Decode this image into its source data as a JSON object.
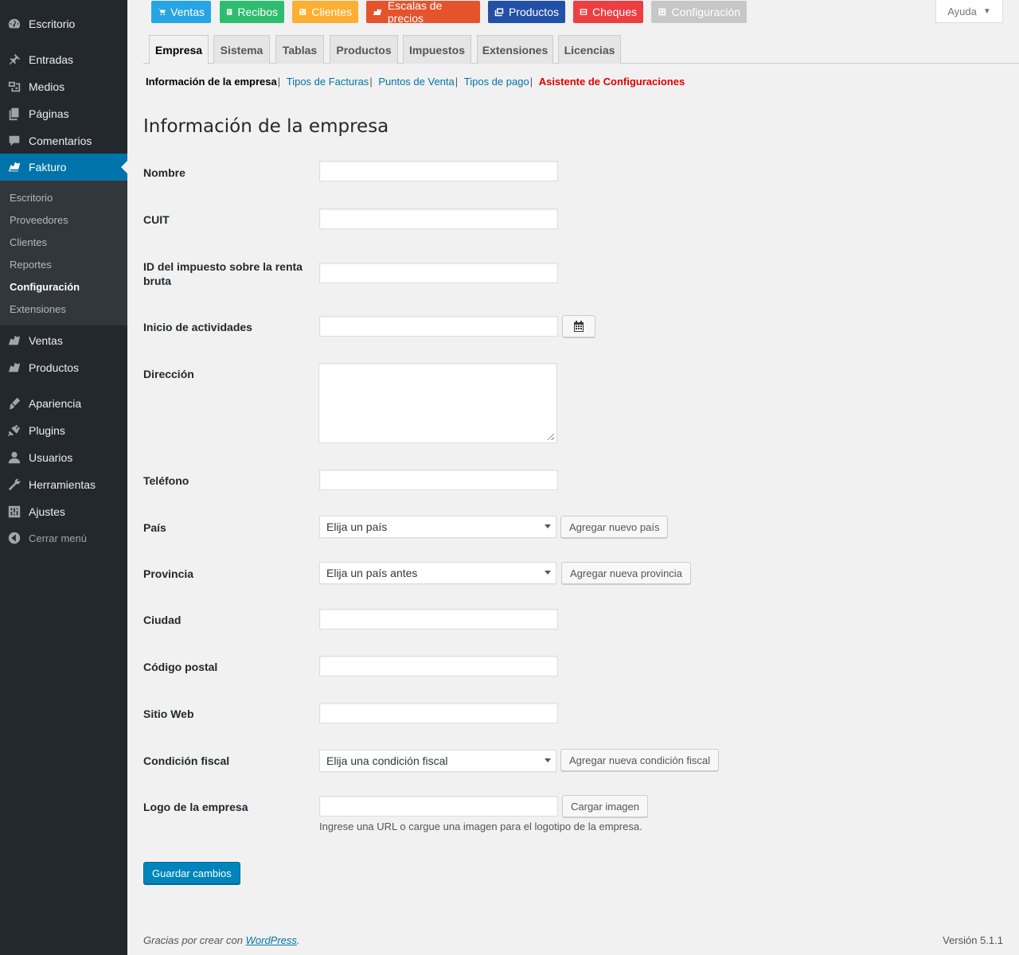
{
  "sidebar": {
    "items": [
      {
        "label": "Escritorio",
        "icon": "dashboard-icon"
      },
      {
        "label": "Entradas",
        "icon": "pin-icon"
      },
      {
        "label": "Medios",
        "icon": "media-icon"
      },
      {
        "label": "Páginas",
        "icon": "pages-icon"
      },
      {
        "label": "Comentarios",
        "icon": "comments-icon"
      },
      {
        "label": "Fakturo",
        "icon": "fakturo-icon"
      },
      {
        "label": "Ventas",
        "icon": "fakturo-icon"
      },
      {
        "label": "Productos",
        "icon": "fakturo-icon"
      },
      {
        "label": "Apariencia",
        "icon": "brush-icon"
      },
      {
        "label": "Plugins",
        "icon": "plug-icon"
      },
      {
        "label": "Usuarios",
        "icon": "user-icon"
      },
      {
        "label": "Herramientas",
        "icon": "wrench-icon"
      },
      {
        "label": "Ajustes",
        "icon": "settings-icon"
      },
      {
        "label": "Cerrar menú",
        "icon": "collapse-icon"
      }
    ],
    "submenu": [
      "Escritorio",
      "Proveedores",
      "Clientes",
      "Reportes",
      "Configuración",
      "Extensiones"
    ]
  },
  "toolbar": {
    "buttons": [
      {
        "label": "Ventas",
        "color": "#26a4e3"
      },
      {
        "label": "Recibos",
        "color": "#2ebd6e"
      },
      {
        "label": "Clientes",
        "color": "#fbb034"
      },
      {
        "label": "Escalas de precios",
        "color": "#e4532c"
      },
      {
        "label": "Productos",
        "color": "#2350a7"
      },
      {
        "label": "Cheques",
        "color": "#ed3e44"
      },
      {
        "label": "Configuración",
        "color": "#c7c7c7"
      }
    ],
    "help": "Ayuda"
  },
  "tabs": [
    "Empresa",
    "Sistema",
    "Tablas",
    "Productos",
    "Impuestos",
    "Extensiones",
    "Licencias"
  ],
  "subnav": {
    "current": "Información de la empresa",
    "links": [
      "Tipos de Facturas",
      "Puntos de Venta",
      "Tipos de pago"
    ],
    "wizard": "Asistente de Configuraciones",
    "separator": "|"
  },
  "page": {
    "title": "Información de la empresa"
  },
  "form": {
    "nombre": {
      "label": "Nombre",
      "value": ""
    },
    "cuit": {
      "label": "CUIT",
      "value": ""
    },
    "iibb": {
      "label": "ID del impuesto sobre la renta bruta",
      "value": ""
    },
    "inicio": {
      "label": "Inicio de actividades",
      "value": ""
    },
    "direccion": {
      "label": "Dirección",
      "value": ""
    },
    "telefono": {
      "label": "Teléfono",
      "value": ""
    },
    "pais": {
      "label": "País",
      "selected": "Elija un país",
      "add_button": "Agregar nuevo país"
    },
    "provincia": {
      "label": "Provincia",
      "selected": "Elija un país antes",
      "add_button": "Agregar nueva provincia"
    },
    "ciudad": {
      "label": "Ciudad",
      "value": ""
    },
    "postal": {
      "label": "Código postal",
      "value": ""
    },
    "web": {
      "label": "Sitio Web",
      "value": ""
    },
    "condicion": {
      "label": "Condición fiscal",
      "selected": "Elija una condición fiscal",
      "add_button": "Agregar nueva condición fiscal"
    },
    "logo": {
      "label": "Logo de la empresa",
      "value": "",
      "upload_button": "Cargar imagen",
      "description": "Ingrese una URL o cargue una imagen para el logotipo de la empresa."
    },
    "save": "Guardar cambios"
  },
  "footer": {
    "thanks_prefix": "Gracias por crear con",
    "wp_link": "WordPress",
    "thanks_suffix": ".",
    "version": "Versión 5.1.1"
  }
}
